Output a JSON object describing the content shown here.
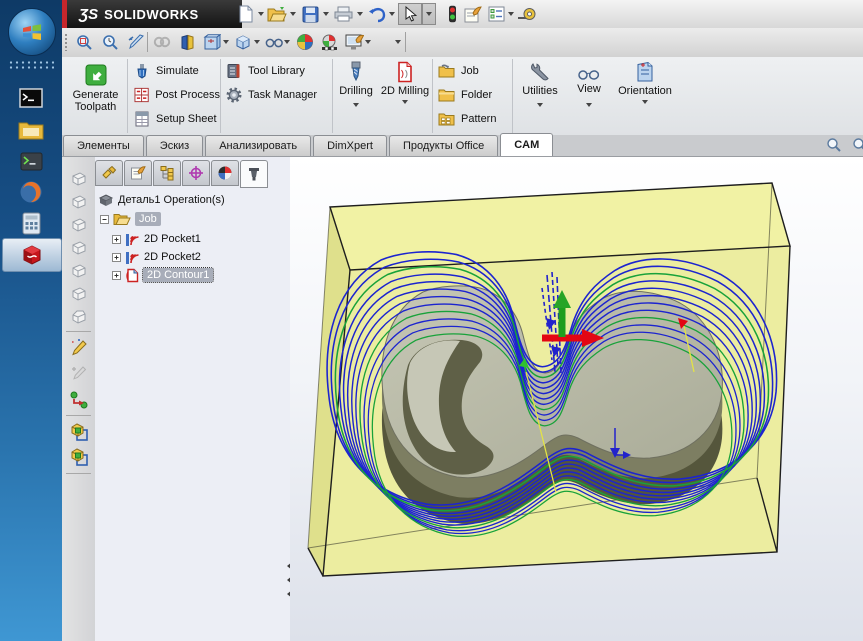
{
  "colors": {
    "taskbar_top": "#0e3a66",
    "taskbar_bottom": "#3f97d3",
    "accent_red": "#c6262c",
    "titlebar_bg": "#1c1c1c",
    "ribbon_bg": "#e4e6e9",
    "panel_bg": "#eceef5",
    "stock_yellow": "#f1f2a4",
    "part_gray": "#b9bba9",
    "wall_dark": "#55563c",
    "toolpath_blue": "#1c24cf",
    "toolpath_green": "#18a23a",
    "axis_red": "#e30613",
    "axis_green": "#1e9e1e",
    "plunge_blue": "#2222cc",
    "rapid_yellow": "#e3e345"
  },
  "taskbar": {
    "icons": [
      {
        "name": "windows-start"
      },
      {
        "name": "command-prompt"
      },
      {
        "name": "file-explorer"
      },
      {
        "name": "terminal"
      },
      {
        "name": "firefox"
      },
      {
        "name": "calculator"
      },
      {
        "name": "solidworks",
        "active": true
      }
    ]
  },
  "titlebar": {
    "logo": "ƷS",
    "brand": "SOLIDWORKS",
    "buttons": [
      {
        "name": "new"
      },
      {
        "name": "open"
      },
      {
        "name": "save"
      },
      {
        "name": "print"
      },
      {
        "name": "undo"
      },
      {
        "name": "select"
      },
      {
        "name": "rebuild-traffic-light"
      },
      {
        "name": "properties"
      },
      {
        "name": "options-list"
      },
      {
        "name": "measure"
      }
    ]
  },
  "view_toolbar": {
    "buttons": [
      {
        "name": "zoom-to-fit"
      },
      {
        "name": "zoom-to-area"
      },
      {
        "name": "previous-view"
      },
      {
        "name": "link-view"
      },
      {
        "name": "section-view"
      },
      {
        "name": "drawing-view"
      },
      {
        "name": "view-cube"
      },
      {
        "name": "display-style-glasses"
      },
      {
        "name": "shaded-ball"
      },
      {
        "name": "render-preview"
      },
      {
        "name": "screen-capture"
      }
    ]
  },
  "ribbon": {
    "groups": [
      {
        "items": [
          {
            "label": "Generate Toolpath",
            "icon": "generate-toolpath"
          }
        ]
      },
      {
        "items": [
          {
            "label": "Simulate",
            "icon": "simulate-tool"
          },
          {
            "label": "Post Process",
            "icon": "post-process-g-code"
          },
          {
            "label": "Setup Sheet",
            "icon": "setup-sheet"
          }
        ]
      },
      {
        "items": [
          {
            "label": "Tool Library",
            "icon": "tool-library-book"
          },
          {
            "label": "Task Manager",
            "icon": "task-manager-gear"
          }
        ]
      },
      {
        "items": [
          {
            "label": "Drilling",
            "icon": "drill-bit",
            "dropdown": true
          },
          {
            "label": "2D Milling",
            "icon": "2d-milling-doc",
            "dropdown": true
          }
        ]
      },
      {
        "items": [
          {
            "label": "Job",
            "icon": "job-folder"
          },
          {
            "label": "Folder",
            "icon": "folder"
          },
          {
            "label": "Pattern",
            "icon": "pattern-folder"
          }
        ]
      },
      {
        "items": [
          {
            "label": "Utilities",
            "icon": "wrench",
            "dropdown": true
          },
          {
            "label": "View",
            "icon": "glasses",
            "dropdown": true
          },
          {
            "label": "Orientation",
            "icon": "orientation-doc",
            "dropdown": true
          }
        ]
      }
    ]
  },
  "command_tabs": {
    "items": [
      {
        "label": "Элементы"
      },
      {
        "label": "Эскиз"
      },
      {
        "label": "Анализировать"
      },
      {
        "label": "DimXpert"
      },
      {
        "label": "Продукты Office"
      },
      {
        "label": "CAM",
        "active": true
      }
    ],
    "right_icons": [
      {
        "name": "magnifier"
      },
      {
        "name": "magnifier-partial"
      }
    ]
  },
  "left_strip": {
    "icons": [
      {
        "name": "view-cube-front"
      },
      {
        "name": "view-cube-back"
      },
      {
        "name": "view-cube-left"
      },
      {
        "name": "view-cube-right"
      },
      {
        "name": "view-cube-top"
      },
      {
        "name": "view-cube-bottom"
      },
      {
        "name": "view-cube-isometric"
      },
      {
        "name": "edit-sketch"
      },
      {
        "name": "add-sketch"
      },
      {
        "name": "flow-arrow"
      },
      {
        "name": "assembly-feature-1"
      },
      {
        "name": "assembly-feature-2"
      }
    ]
  },
  "manager_tabs": {
    "items": [
      {
        "name": "feature-manager"
      },
      {
        "name": "property-manager"
      },
      {
        "name": "configuration-manager"
      },
      {
        "name": "dimxpert-manager"
      },
      {
        "name": "display-manager"
      },
      {
        "name": "cam-operation-tree",
        "active": true
      }
    ]
  },
  "tree": {
    "root_label": "Деталь1 Operation(s)",
    "job_label": "Job",
    "children": [
      {
        "label": "2D Pocket1"
      },
      {
        "label": "2D Pocket2"
      },
      {
        "label": "2D Contour1",
        "selected": true
      }
    ]
  },
  "viewport": {
    "toolpath_levels": 12,
    "entities": [
      "stock-box",
      "machined-part",
      "boss-pocket",
      "toolpath-contours",
      "x-axis-arrow-red",
      "z-axis-arrow-green",
      "plunge-moves-blue",
      "rapid-moves-yellow"
    ]
  }
}
